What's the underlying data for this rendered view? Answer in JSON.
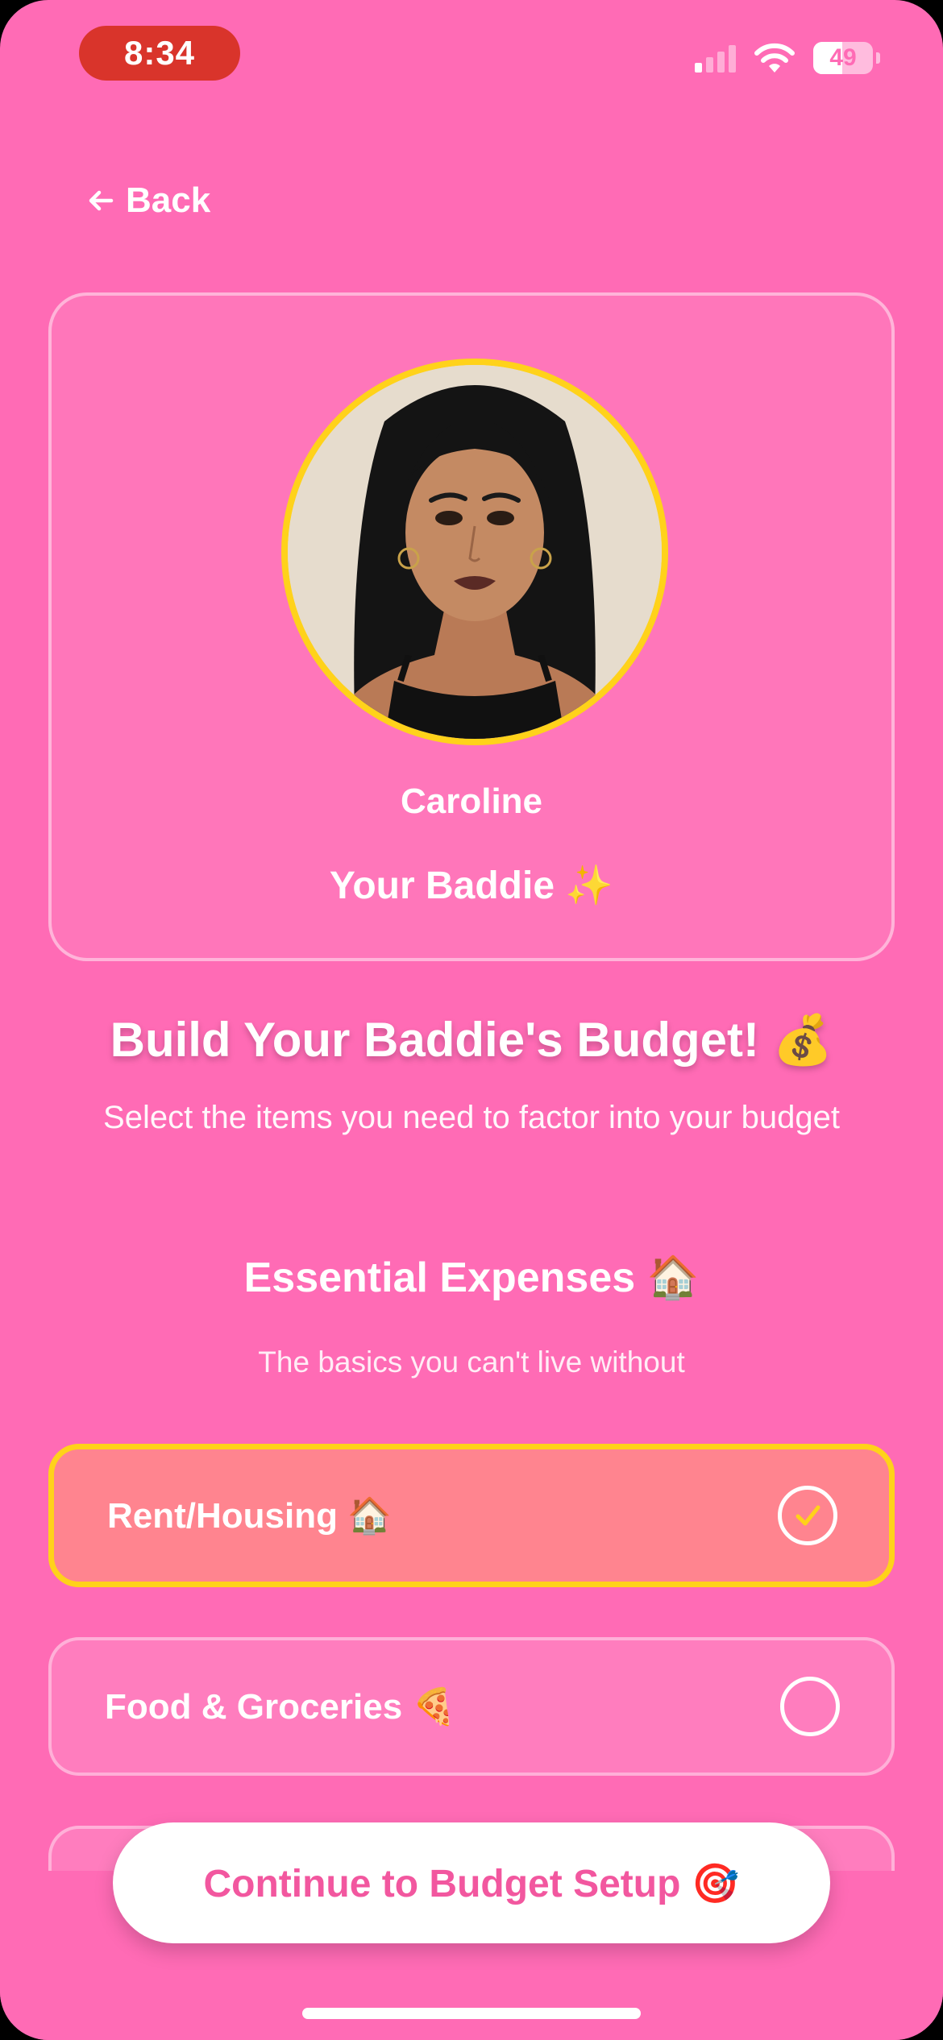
{
  "status_bar": {
    "time": "8:34",
    "battery_level": "49",
    "signal_bars_active": 1,
    "signal_bars_total": 4
  },
  "nav": {
    "back_label": "Back"
  },
  "profile": {
    "name": "Caroline",
    "role": "Your Baddie ✨"
  },
  "header": {
    "title": "Build Your Baddie's Budget! 💰",
    "subtitle": "Select the items you need to factor into your budget"
  },
  "section": {
    "title": "Essential Expenses 🏠",
    "subtitle": "The basics you can't live without"
  },
  "expenses": [
    {
      "label": "Rent/Housing 🏠",
      "selected": true
    },
    {
      "label": "Food & Groceries 🍕",
      "selected": false
    }
  ],
  "footer": {
    "continue_label": "Continue to Budget Setup 🎯"
  },
  "colors": {
    "background": "#ff6bb5",
    "accent_yellow": "#ffd21a",
    "selected_fill": "#ff848f",
    "button_text": "#f2579f",
    "time_pill": "#d9342b"
  }
}
